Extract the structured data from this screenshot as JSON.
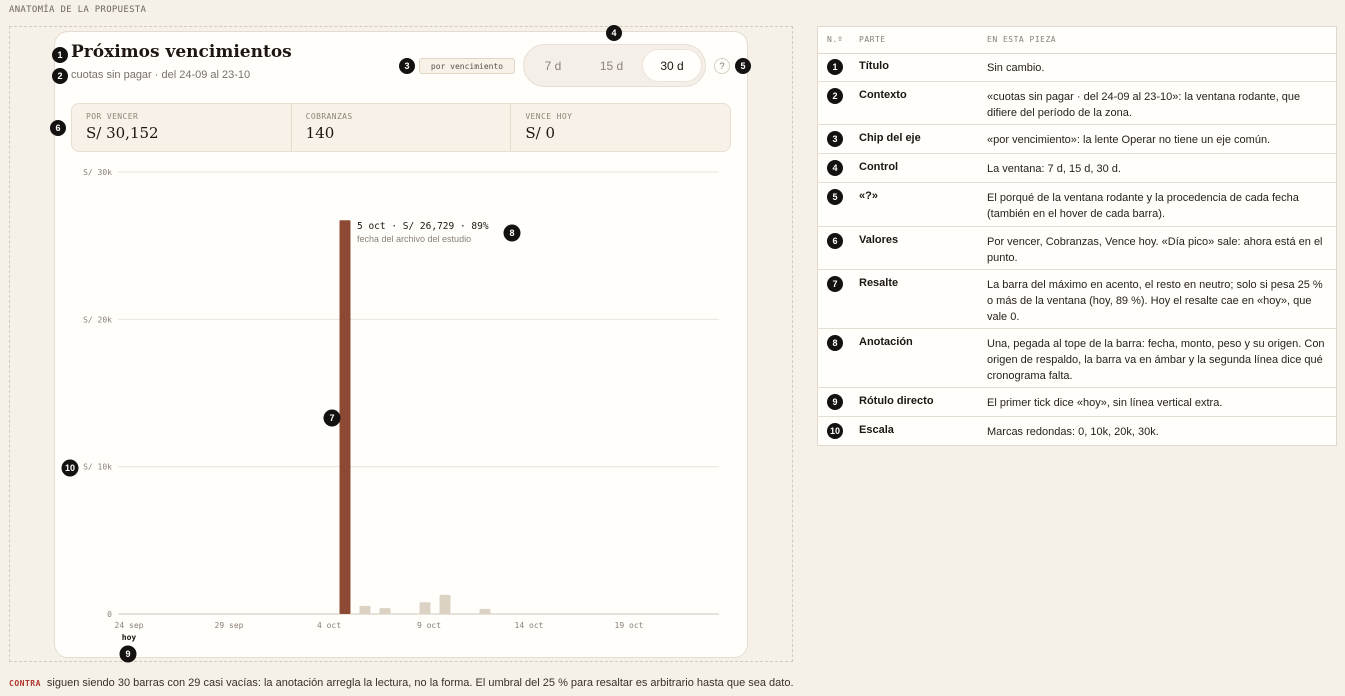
{
  "section_label": "ANATOMÍA DE LA PROPUESTA",
  "widget": {
    "title": "Próximos vencimientos",
    "subtitle": "cuotas sin pagar · del 24-09 al 23-10",
    "axis_chip": "por vencimiento",
    "window_options": [
      "7 d",
      "15 d",
      "30 d"
    ],
    "window_selected": "30 d",
    "help_label": "?",
    "kpis": [
      {
        "label": "POR VENCER",
        "value": "S/ 30,152"
      },
      {
        "label": "COBRANZAS",
        "value": "140"
      },
      {
        "label": "VENCE HOY",
        "value": "S/ 0"
      }
    ],
    "today_label": "hoy",
    "annotation": {
      "line1": "5 oct · S/ 26,729 · 89%",
      "line2": "fecha del archivo del estudio"
    }
  },
  "chart_data": {
    "type": "bar",
    "start_date": "2024-09-24",
    "x_tick_labels": [
      "24 sep",
      "29 sep",
      "4 oct",
      "9 oct",
      "14 oct",
      "19 oct"
    ],
    "y_ticks": [
      0,
      10000,
      20000,
      30000
    ],
    "y_tick_labels": [
      "0",
      "S/ 10k",
      "S/ 20k",
      "S/ 30k"
    ],
    "ylim": [
      0,
      30000
    ],
    "categories": [
      "24 sep",
      "25 sep",
      "26 sep",
      "27 sep",
      "28 sep",
      "29 sep",
      "30 sep",
      "1 oct",
      "2 oct",
      "3 oct",
      "4 oct",
      "5 oct",
      "6 oct",
      "7 oct",
      "8 oct",
      "9 oct",
      "10 oct",
      "11 oct",
      "12 oct",
      "13 oct",
      "14 oct",
      "15 oct",
      "16 oct",
      "17 oct",
      "18 oct",
      "19 oct",
      "20 oct",
      "21 oct",
      "22 oct",
      "23 oct"
    ],
    "values": [
      0,
      0,
      0,
      0,
      0,
      0,
      0,
      0,
      0,
      0,
      0,
      26729,
      550,
      400,
      0,
      800,
      1300,
      0,
      350,
      0,
      0,
      0,
      0,
      0,
      0,
      0,
      0,
      0,
      0,
      0
    ],
    "highlight_index": 11,
    "colors": {
      "highlight": "#8c4a35",
      "neutral": "#dcd2c4",
      "grid": "#ebe4da",
      "axis": "#cfc5b8"
    }
  },
  "badges": {
    "title": "1",
    "context": "2",
    "chip": "3",
    "control": "4",
    "help": "5",
    "values": "6",
    "highlight": "7",
    "annotation": "8",
    "today": "9",
    "scale": "10"
  },
  "table": {
    "headers": [
      "N.º",
      "PARTE",
      "EN ESTA PIEZA"
    ],
    "rows": [
      {
        "n": "1",
        "part": "Título",
        "desc": "Sin cambio."
      },
      {
        "n": "2",
        "part": "Contexto",
        "desc": "«cuotas sin pagar · del 24-09 al 23-10»: la ventana rodante, que difiere del período de la zona."
      },
      {
        "n": "3",
        "part": "Chip del eje",
        "desc": "«por vencimiento»: la lente Operar no tiene un eje común."
      },
      {
        "n": "4",
        "part": "Control",
        "desc": "La ventana: 7 d, 15 d, 30 d."
      },
      {
        "n": "5",
        "part": "«?»",
        "desc": "El porqué de la ventana rodante y la procedencia de cada fecha (también en el hover de cada barra)."
      },
      {
        "n": "6",
        "part": "Valores",
        "desc": "Por vencer, Cobranzas, Vence hoy. «Día pico» sale: ahora está en el punto."
      },
      {
        "n": "7",
        "part": "Resalte",
        "desc": "La barra del máximo en acento, el resto en neutro; solo si pesa 25 % o más de la ventana (hoy, 89 %). Hoy el resalte cae en «hoy», que vale 0."
      },
      {
        "n": "8",
        "part": "Anotación",
        "desc": "Una, pegada al tope de la barra: fecha, monto, peso y su origen. Con origen de respaldo, la barra va en ámbar y la segunda línea dice qué cronograma falta."
      },
      {
        "n": "9",
        "part": "Rótulo directo",
        "desc": "El primer tick dice «hoy», sin línea vertical extra."
      },
      {
        "n": "10",
        "part": "Escala",
        "desc": "Marcas redondas: 0, 10k, 20k, 30k."
      }
    ]
  },
  "footer": {
    "tag": "CONTRA",
    "text": "siguen siendo 30 barras con 29 casi vacías: la anotación arregla la lectura, no la forma. El umbral del 25 % para resaltar es arbitrario hasta que sea dato."
  }
}
